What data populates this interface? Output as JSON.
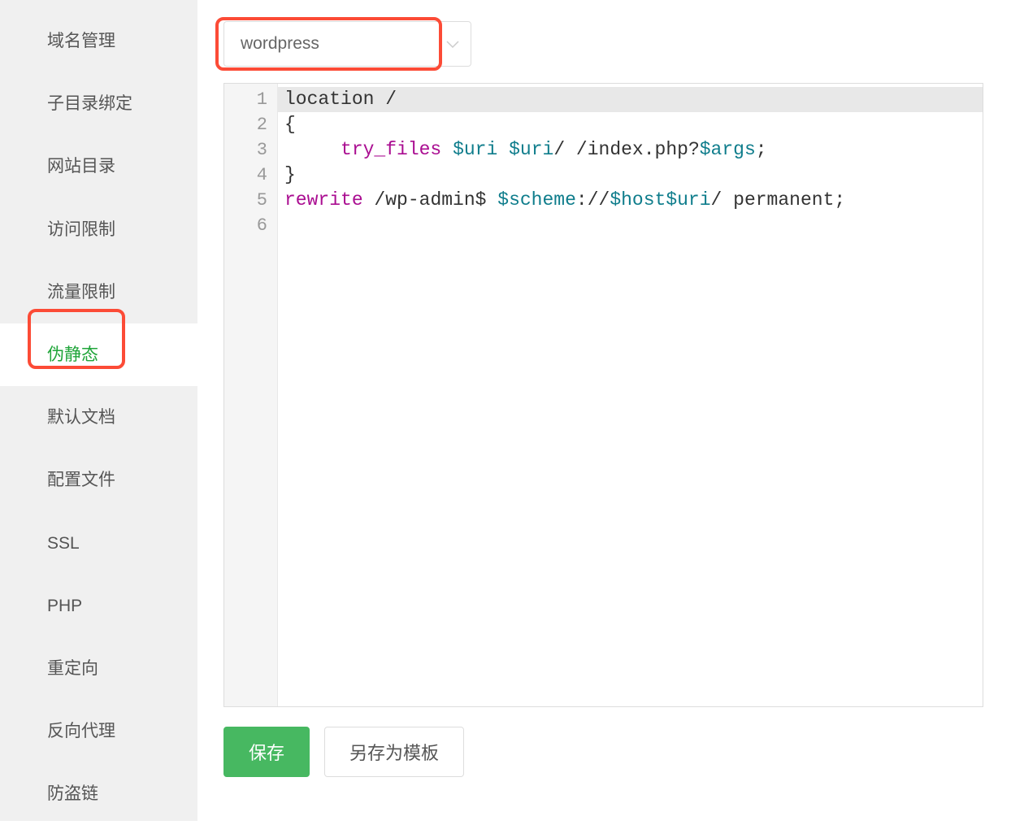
{
  "sidebar": {
    "items": [
      {
        "label": "域名管理",
        "active": false
      },
      {
        "label": "子目录绑定",
        "active": false
      },
      {
        "label": "网站目录",
        "active": false
      },
      {
        "label": "访问限制",
        "active": false
      },
      {
        "label": "流量限制",
        "active": false
      },
      {
        "label": "伪静态",
        "active": true
      },
      {
        "label": "默认文档",
        "active": false
      },
      {
        "label": "配置文件",
        "active": false
      },
      {
        "label": "SSL",
        "active": false
      },
      {
        "label": "PHP",
        "active": false
      },
      {
        "label": "重定向",
        "active": false
      },
      {
        "label": "反向代理",
        "active": false
      },
      {
        "label": "防盗链",
        "active": false
      }
    ]
  },
  "dropdown": {
    "selected": "wordpress"
  },
  "code": {
    "lines": [
      {
        "n": 1,
        "active": true,
        "tokens": [
          {
            "t": "location /",
            "c": "text"
          }
        ]
      },
      {
        "n": 2,
        "active": false,
        "tokens": [
          {
            "t": "{",
            "c": "text"
          }
        ]
      },
      {
        "n": 3,
        "active": false,
        "tokens": [
          {
            "t": "     ",
            "c": "text"
          },
          {
            "t": "try_files",
            "c": "keyword"
          },
          {
            "t": " ",
            "c": "text"
          },
          {
            "t": "$uri",
            "c": "var"
          },
          {
            "t": " ",
            "c": "text"
          },
          {
            "t": "$uri",
            "c": "var"
          },
          {
            "t": "/ /index.php?",
            "c": "text"
          },
          {
            "t": "$args",
            "c": "var"
          },
          {
            "t": ";",
            "c": "text"
          }
        ]
      },
      {
        "n": 4,
        "active": false,
        "tokens": [
          {
            "t": "}",
            "c": "text"
          }
        ]
      },
      {
        "n": 5,
        "active": false,
        "tokens": [
          {
            "t": "",
            "c": "text"
          }
        ]
      },
      {
        "n": 6,
        "active": false,
        "tokens": [
          {
            "t": "rewrite",
            "c": "keyword"
          },
          {
            "t": " /wp-admin$ ",
            "c": "text"
          },
          {
            "t": "$scheme",
            "c": "var"
          },
          {
            "t": "://",
            "c": "text"
          },
          {
            "t": "$host$uri",
            "c": "var"
          },
          {
            "t": "/ permanent;",
            "c": "text"
          }
        ]
      }
    ]
  },
  "buttons": {
    "save": "保存",
    "saveAsTemplate": "另存为模板"
  }
}
